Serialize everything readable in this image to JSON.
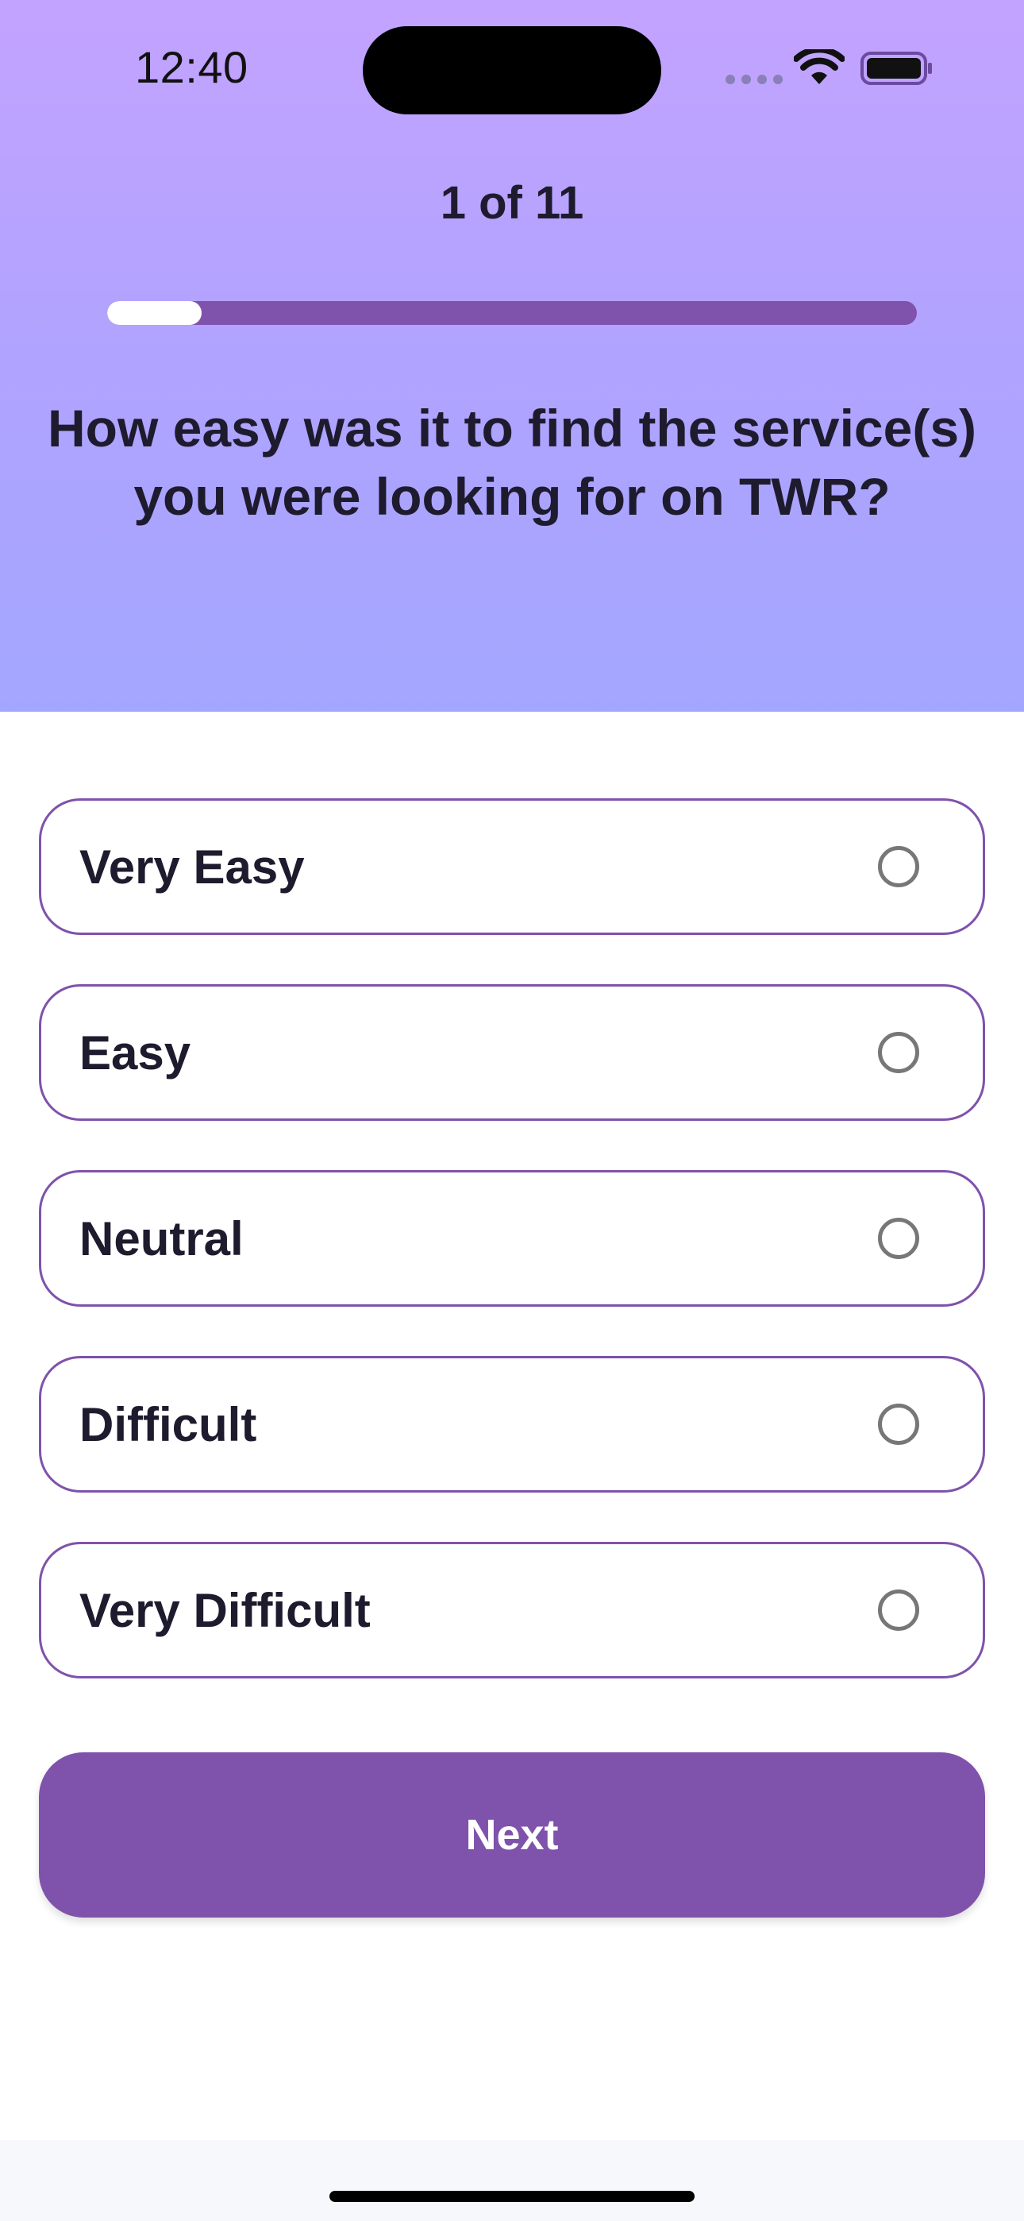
{
  "status_bar": {
    "time": "12:40",
    "icons": [
      "signal-dots-icon",
      "wifi-icon",
      "battery-icon"
    ]
  },
  "survey": {
    "progress_label": "1 of 11",
    "progress_fraction": 0.1171,
    "question": "How easy was it to find the service(s) you were looking for on TWR?",
    "options": [
      {
        "label": "Very Easy",
        "selected": false
      },
      {
        "label": "Easy",
        "selected": false
      },
      {
        "label": "Neutral",
        "selected": false
      },
      {
        "label": "Difficult",
        "selected": false
      },
      {
        "label": "Very Difficult",
        "selected": false
      }
    ],
    "next_label": "Next"
  },
  "colors": {
    "accent": "#7f52ab",
    "header_top": "#c3a3ff",
    "header_bottom": "#a3a6ff",
    "text": "#1f1b2e",
    "radio_border": "#777777"
  }
}
